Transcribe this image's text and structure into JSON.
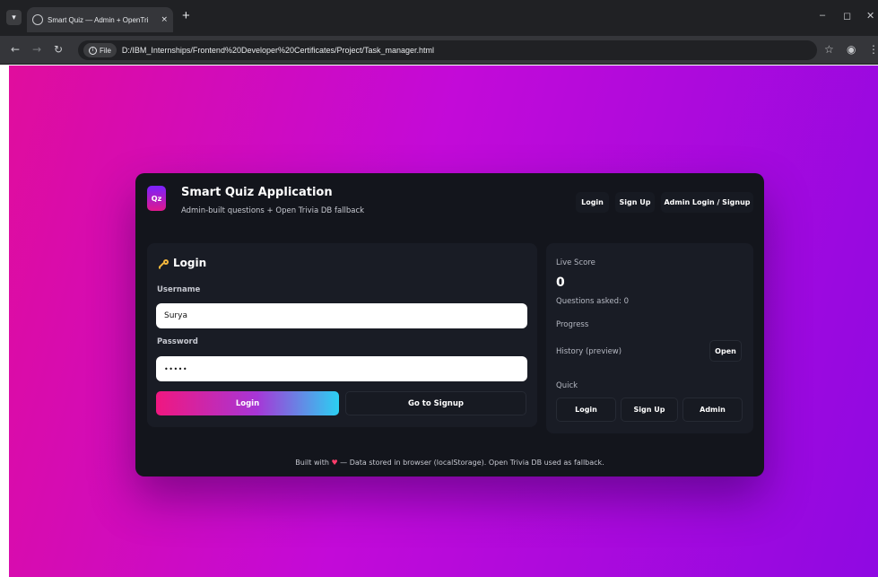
{
  "browser": {
    "tab_title": "Smart Quiz — Admin + OpenTri",
    "tab_close": "×",
    "new_tab": "+",
    "file_chip": "File",
    "url": "D:/IBM_Internships/Frontend%20Developer%20Certificates/Project/Task_manager.html",
    "icons": {
      "dropdown": "chevron-down-icon",
      "favicon": "globe-icon",
      "back": "back-arrow-icon",
      "forward": "forward-arrow-icon",
      "reload": "reload-icon",
      "info": "info-icon",
      "bookmark": "star-icon",
      "profile": "profile-icon",
      "menu": "kebab-menu-icon",
      "minimize": "minimize-icon",
      "restore": "restore-icon",
      "close": "close-icon"
    }
  },
  "app": {
    "logo_text": "Qz",
    "title": "Smart Quiz Application",
    "subtitle": "Admin-built questions + Open Trivia DB fallback",
    "nav": {
      "login": "Login",
      "signup": "Sign Up",
      "admin": "Admin Login / Signup"
    }
  },
  "login_form": {
    "icon": "key-icon",
    "heading": "Login",
    "username_label": "Username",
    "username_value": "Surya",
    "password_label": "Password",
    "password_mask": "•••••",
    "login_button": "Login",
    "signup_button": "Go to Signup"
  },
  "score_panel": {
    "live_score_label": "Live Score",
    "live_score_value": "0",
    "questions_asked": "Questions asked: 0",
    "progress_label": "Progress",
    "history_label": "History (preview)",
    "open_button": "Open",
    "quick_label": "Quick",
    "quick": {
      "login": "Login",
      "signup": "Sign Up",
      "admin": "Admin"
    }
  },
  "footer": {
    "before": "Built with ",
    "heart": "♥",
    "after": " — Data stored in browser (localStorage). Open Trivia DB used as fallback."
  },
  "colors": {
    "page_gradient_start": "#e00d9d",
    "page_gradient_end": "#8f09e2",
    "card_bg": "#13151c",
    "panel_bg": "#191c25",
    "accent_pink": "#f01780",
    "accent_cyan": "#2bd0f2"
  }
}
